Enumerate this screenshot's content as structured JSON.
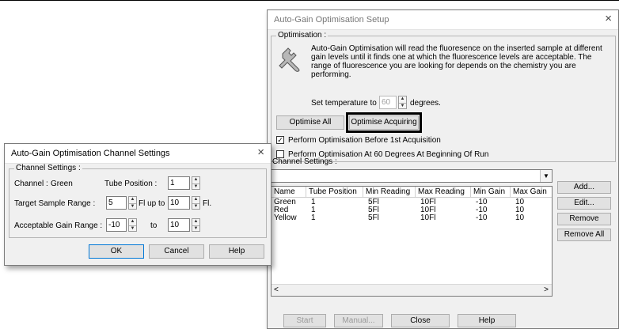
{
  "main": {
    "title": "Auto-Gain Optimisation Setup",
    "close_glyph": "×",
    "optimisation_group": "Optimisation :",
    "description": "Auto-Gain Optimisation will read the fluoresence on the inserted sample at different gain levels until it finds one at which the fluorescence levels are acceptable. The range of fluorescence you are looking for depends on the chemistry you are performing.",
    "set_temp_label": "Set temperature to",
    "temp_value": "60",
    "temp_unit": "degrees.",
    "optimise_all": "Optimise All",
    "optimise_acquiring": "Optimise Acquiring",
    "perform_before_label": "Perform Optimisation Before 1st Acquisition",
    "perform_before_checked": true,
    "perform_at_label": "Perform Optimisation At 60 Degrees At Beginning Of Run",
    "perform_at_checked": false,
    "channel_settings_group": "Channel Settings :",
    "combo_value": "",
    "columns": [
      "Name",
      "Tube Position",
      "Min Reading",
      "Max Reading",
      "Min Gain",
      "Max Gain"
    ],
    "rows": [
      [
        "Green",
        "1",
        "5Fl",
        "10Fl",
        "-10",
        "10"
      ],
      [
        "Red",
        "1",
        "5Fl",
        "10Fl",
        "-10",
        "10"
      ],
      [
        "Yellow",
        "1",
        "5Fl",
        "10Fl",
        "-10",
        "10"
      ]
    ],
    "buttons": {
      "add": "Add...",
      "edit": "Edit...",
      "remove": "Remove",
      "remove_all": "Remove All",
      "start": "Start",
      "manual": "Manual...",
      "close": "Close",
      "help": "Help"
    }
  },
  "dialog": {
    "title": "Auto-Gain Optimisation Channel Settings",
    "close_glyph": "×",
    "group": "Channel Settings :",
    "channel_label": "Channel :",
    "channel_value": "Green",
    "tube_position_label": "Tube Position :",
    "tube_position_value": "1",
    "target_range_label": "Target Sample Range :",
    "target_min": "5",
    "fl_up_to": "Fl up to",
    "target_max": "10",
    "fl_unit": "Fl.",
    "gain_range_label": "Acceptable Gain Range :",
    "gain_min": "-10",
    "to": "to",
    "gain_max": "10",
    "ok": "OK",
    "cancel": "Cancel",
    "help": "Help"
  },
  "icons": {
    "wrench": "wrench-icon"
  }
}
